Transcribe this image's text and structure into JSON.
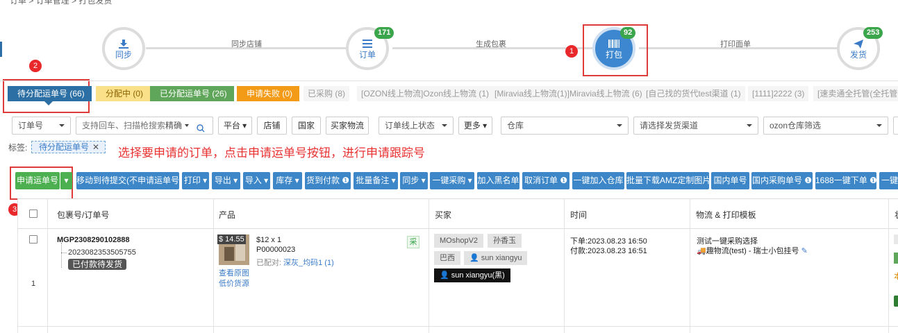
{
  "breadcrumb": {
    "text": "订单 > 订单管理 > 打包发货"
  },
  "steps": [
    {
      "label": "同步",
      "icon": "download-icon",
      "badge": ""
    },
    {
      "label": "订单",
      "icon": "list-icon",
      "badge": "171"
    },
    {
      "label": "打包",
      "icon": "barcode-icon",
      "badge": "92"
    },
    {
      "label": "发货",
      "icon": "send-icon",
      "badge": "253"
    }
  ],
  "step_lines": [
    "同步店铺",
    "生成包裹",
    "打印面单"
  ],
  "markers": [
    "1",
    "2",
    "3"
  ],
  "status_tabs": [
    {
      "label": "待分配运单号 (66)"
    },
    {
      "label": "分配中 (0)"
    },
    {
      "label": "已分配运单号 (26)"
    },
    {
      "label": "申请失败 (0)"
    },
    {
      "label": "已采购 (8)"
    },
    {
      "label": "[OZON线上物流]Ozon线上物流 (1)"
    },
    {
      "label": "[Miravia线上物流(1)]Miravia线上物流 (6)"
    },
    {
      "label": "[自己找的货代test渠道 (1)"
    },
    {
      "label": "[1111]2222 (3)"
    },
    {
      "label": "[速卖通全托管(全托管CS"
    }
  ],
  "filters": {
    "order_no": "订单号",
    "search_placeholder": "支持回车、扫描枪搜索",
    "precision": "精确",
    "platform": "平台",
    "store": "店铺",
    "country": "国家",
    "buyer_logistics": "买家物流",
    "online_status": "订单线上状态",
    "more": "更多",
    "warehouse": "仓库",
    "channel": "请选择发货渠道",
    "ozon_filter": "ozon仓库筛选"
  },
  "tags": {
    "label": "标签:",
    "chip": "待分配运单号"
  },
  "instruction": "选择要申请的订单，点击申请运单号按钮，进行申请跟踪号",
  "actions": [
    "申请运单号",
    "移动到待提交(不申请运单号)",
    "打印",
    "导出",
    "导入",
    "库存",
    "货到付款",
    "批量备注",
    "同步",
    "一键采购",
    "加入黑名单",
    "取消订单",
    "一键加入仓库",
    "批量下载AMZ定制图片",
    "国内单号",
    "国内采购单号",
    "1688一键下单",
    "一键"
  ],
  "table": {
    "headers": [
      "包裹号/订单号",
      "产品",
      "买家",
      "时间",
      "物流 & 打印模板",
      "状"
    ],
    "rows": [
      {
        "index": "1",
        "package_no": "MGP2308290102888",
        "order_no": "2023082353505755",
        "status": "已付款待发货",
        "price_badge": "$ 14.55",
        "price_qty": "$12 x 1",
        "sku": "P00000023",
        "matched_label": "已配对:",
        "matched_value": "深灰_均码1 (1)",
        "view_image": "查看原图",
        "cheap_source": "低价货源",
        "purchase_tag": "采",
        "shop": "MOshopV2",
        "buyer_name": "孙香玉",
        "country": "巴西",
        "buyer_user": "sun xiangyu",
        "blacklist": "sun xiangyu(黑)",
        "order_time": "下单:2023.08.23 16:50",
        "pay_time": "付款:2023.08.23 16:51",
        "logistics_title": "测试一键采购选择",
        "logistics_detail": "趣物流(test) - 瑞士小包挂号",
        "extra_note": "本"
      }
    ]
  }
}
